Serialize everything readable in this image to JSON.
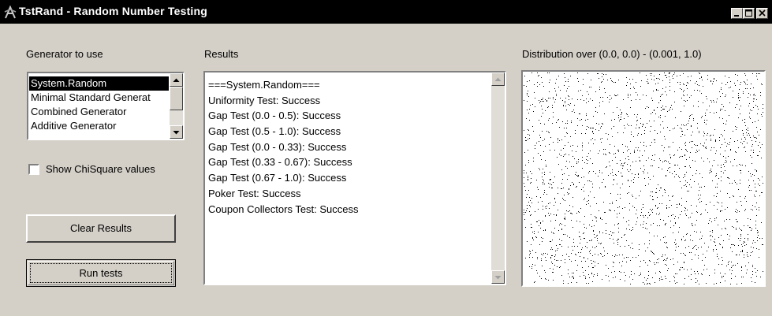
{
  "window": {
    "title": "TstRand - Random Number Testing",
    "icon": "app-icon",
    "controls": [
      "minimize-icon",
      "maximize-icon",
      "close-icon"
    ]
  },
  "generator": {
    "label": "Generator to use",
    "items": [
      {
        "label": "System.Random",
        "selected": true
      },
      {
        "label": "Minimal Standard Generat",
        "selected": false
      },
      {
        "label": "Combined Generator",
        "selected": false
      },
      {
        "label": "Additive Generator",
        "selected": false
      }
    ]
  },
  "options": {
    "chisquare_label": "Show ChiSquare values",
    "chisquare_checked": false
  },
  "buttons": {
    "clear": "Clear Results",
    "run": "Run tests"
  },
  "results": {
    "label": "Results",
    "lines": [
      "===System.Random===",
      "Uniformity Test: Success",
      "Gap Test (0.0 - 0.5): Success",
      "Gap Test (0.5 - 1.0): Success",
      "Gap Test (0.0 - 0.33): Success",
      "Gap Test (0.33 - 0.67): Success",
      "Gap Test (0.67 - 1.0): Success",
      "Poker Test: Success",
      "Coupon Collectors Test: Success"
    ]
  },
  "distribution": {
    "label": "Distribution over (0.0, 0.0) - (0.001, 1.0)",
    "point_color": "#000000"
  },
  "colors": {
    "face": "#d4d0c8",
    "titlebar": "#000000",
    "selection": "#000000"
  }
}
